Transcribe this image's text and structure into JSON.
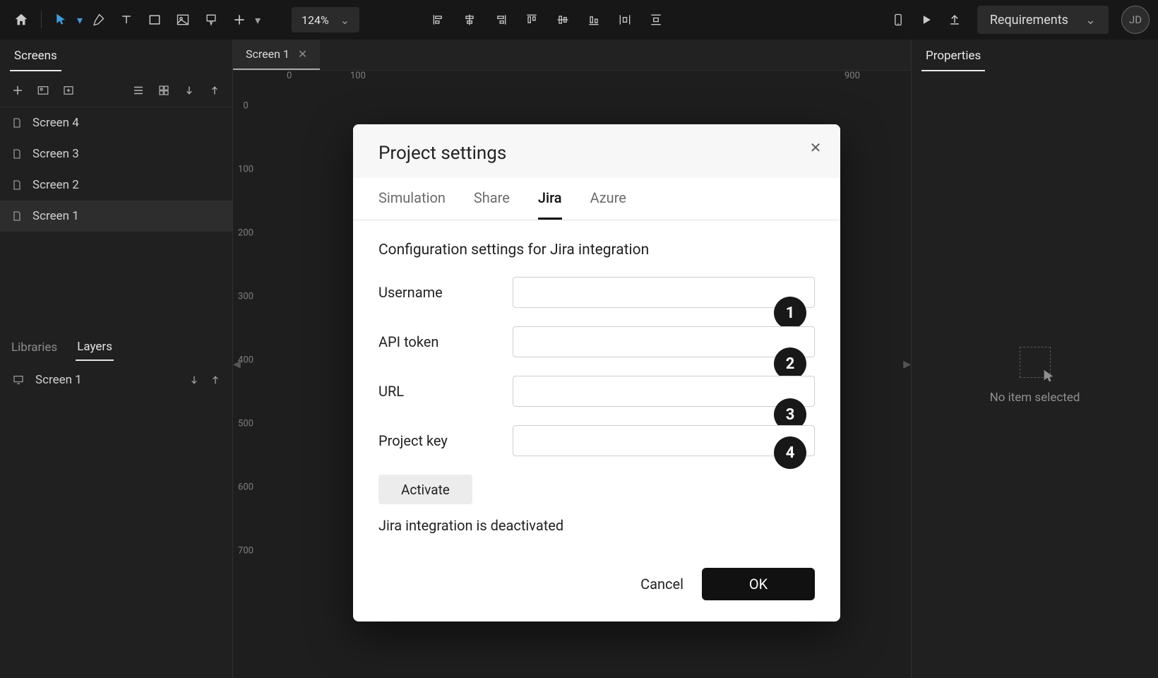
{
  "toolbar": {
    "zoom": "124%",
    "requirements_label": "Requirements",
    "avatar_initials": "JD"
  },
  "ruler_h": [
    "0",
    "100",
    "",
    "",
    "",
    "",
    "",
    "",
    "",
    "900"
  ],
  "ruler_v": [
    "0",
    "100",
    "200",
    "300",
    "400",
    "500",
    "600",
    "700"
  ],
  "left": {
    "screens_tab": "Screens",
    "items": [
      {
        "label": "Screen 4"
      },
      {
        "label": "Screen 3"
      },
      {
        "label": "Screen 2"
      },
      {
        "label": "Screen 1"
      }
    ],
    "libraries_tab": "Libraries",
    "layers_tab": "Layers",
    "layer_root": "Screen 1"
  },
  "canvas": {
    "tab_label": "Screen 1"
  },
  "right": {
    "properties_tab": "Properties",
    "no_selection": "No item selected"
  },
  "modal": {
    "title": "Project settings",
    "tabs": [
      "Simulation",
      "Share",
      "Jira",
      "Azure"
    ],
    "active_tab": 2,
    "section_title": "Configuration settings for Jira integration",
    "fields": [
      {
        "label": "Username",
        "badge": "1"
      },
      {
        "label": "API token",
        "badge": "2"
      },
      {
        "label": "URL",
        "badge": "3"
      },
      {
        "label": "Project key",
        "badge": "4"
      }
    ],
    "activate_label": "Activate",
    "status_text": "Jira integration is deactivated",
    "cancel_label": "Cancel",
    "ok_label": "OK"
  }
}
